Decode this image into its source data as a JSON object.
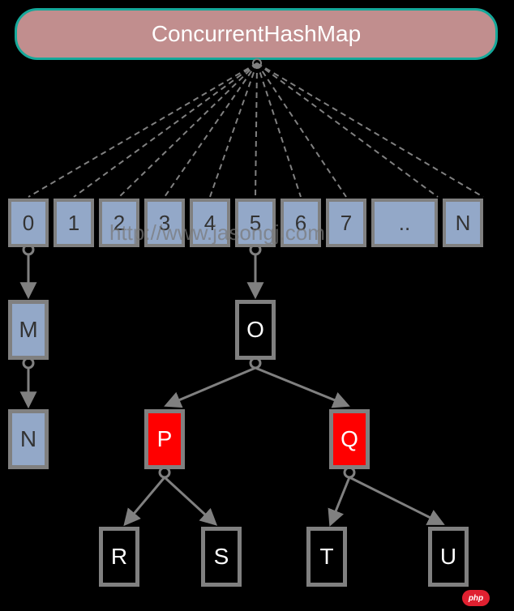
{
  "title": "ConcurrentHashMap",
  "watermark": "http://www.jasongj.com",
  "array": [
    "0",
    "1",
    "2",
    "3",
    "4",
    "5",
    "6",
    "7",
    "..",
    "N"
  ],
  "nodes": {
    "M": "M",
    "N2": "N",
    "O": "O",
    "P": "P",
    "Q": "Q",
    "R": "R",
    "S": "S",
    "T": "T",
    "U": "U"
  },
  "badge": "php",
  "chart_data": {
    "type": "diagram",
    "description": "ConcurrentHashMap Java 8 structure: a title node fanning out (dashed) to an array of N buckets. Bucket 0 has a linked list M -> N. Bucket 5 has a red-black tree rooted at O (black), children P (red) and Q (red), leaves R, S, T, U (black).",
    "array_slots": [
      "0",
      "1",
      "2",
      "3",
      "4",
      "5",
      "6",
      "7",
      "..",
      "N"
    ],
    "bucket_0": {
      "structure": "linked_list",
      "nodes": [
        "M",
        "N"
      ]
    },
    "bucket_5": {
      "structure": "red_black_tree",
      "root": {
        "label": "O",
        "color": "black",
        "left": {
          "label": "P",
          "color": "red",
          "left": {
            "label": "R",
            "color": "black"
          },
          "right": {
            "label": "S",
            "color": "black"
          }
        },
        "right": {
          "label": "Q",
          "color": "red",
          "left": {
            "label": "T",
            "color": "black"
          },
          "right": {
            "label": "U",
            "color": "black"
          }
        }
      }
    }
  }
}
